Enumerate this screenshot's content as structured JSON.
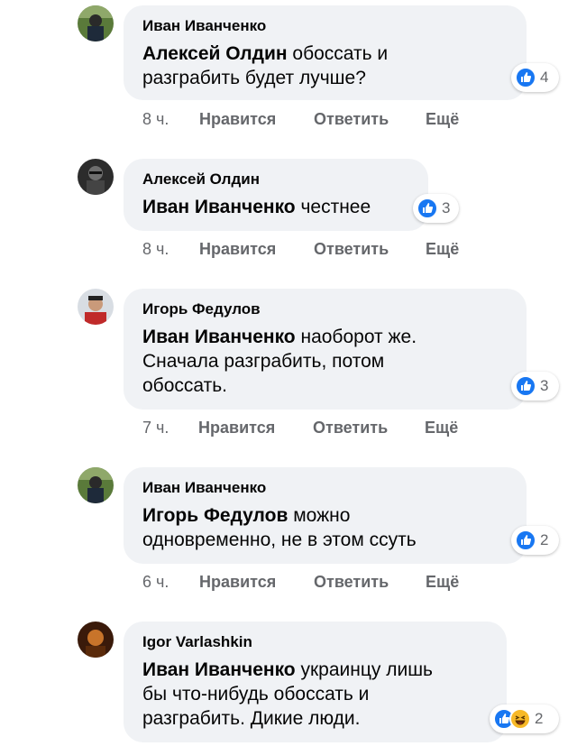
{
  "comments": [
    {
      "author": "Иван Иванченко",
      "mention": "Алексей Олдин",
      "text_line1": " обоссать и",
      "text_line2": "разграбить будет лучше?",
      "text_line3": "",
      "reaction_count": "4",
      "time": "8 ч."
    },
    {
      "author": "Алексей Олдин",
      "mention": "Иван Иванченко",
      "text_line1": " честнее",
      "text_line2": "",
      "text_line3": "",
      "reaction_count": "3",
      "time": "8 ч."
    },
    {
      "author": "Игорь Федулов",
      "mention": "Иван Иванченко",
      "text_line1": " наоборот же.",
      "text_line2": "Сначала разграбить, потом",
      "text_line3": "обоссать.",
      "reaction_count": "3",
      "time": "7 ч."
    },
    {
      "author": "Иван Иванченко",
      "mention": "Игорь Федулов",
      "text_line1": " можно",
      "text_line2": "одновременно, не в этом ссуть",
      "text_line3": "",
      "reaction_count": "2",
      "time": "6 ч."
    },
    {
      "author": "Igor Varlashkin",
      "mention": "Иван Иванченко",
      "text_line1": " украинцу лишь",
      "text_line2": "бы что-нибудь обоссать и",
      "text_line3": "разграбить. Дикие люди.",
      "reaction_count": "2",
      "time": ""
    }
  ],
  "actions": {
    "like": "Нравится",
    "reply": "Ответить",
    "more": "Ещё"
  },
  "icons": {
    "like": "thumbs-up-icon",
    "haha": "laughing-face-icon"
  },
  "colors": {
    "like_blue": "#1877f2",
    "bubble_gray": "#f0f2f5",
    "meta_gray": "#65676b"
  }
}
